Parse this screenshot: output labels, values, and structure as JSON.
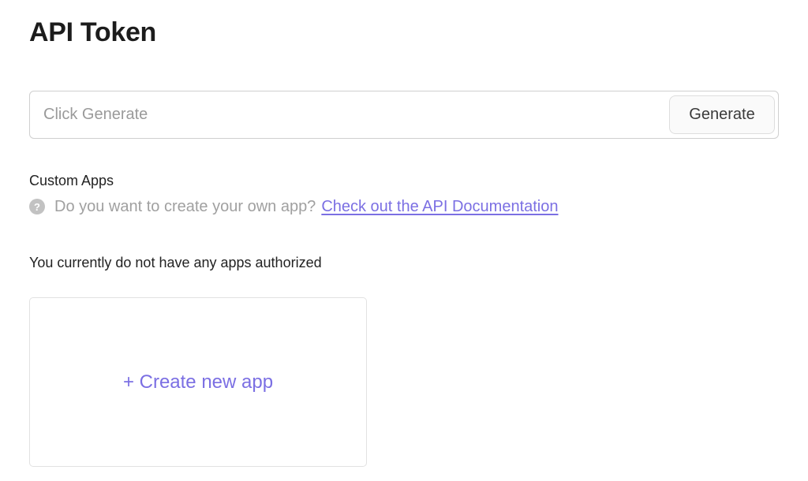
{
  "header": {
    "title": "API Token"
  },
  "token": {
    "placeholder": "Click Generate",
    "value": "",
    "generate_label": "Generate"
  },
  "custom_apps": {
    "label": "Custom Apps",
    "help_icon": "question-circle-icon",
    "help_icon_glyph": "?",
    "help_text": "Do you want to create your own app?",
    "doc_link_label": "Check out the API Documentation",
    "empty_message": "You currently do not have any apps authorized",
    "create_label": "+ Create new app"
  },
  "colors": {
    "accent": "#7b6fe3",
    "muted_text": "#a0a0a0",
    "border": "#cfcfcf"
  }
}
